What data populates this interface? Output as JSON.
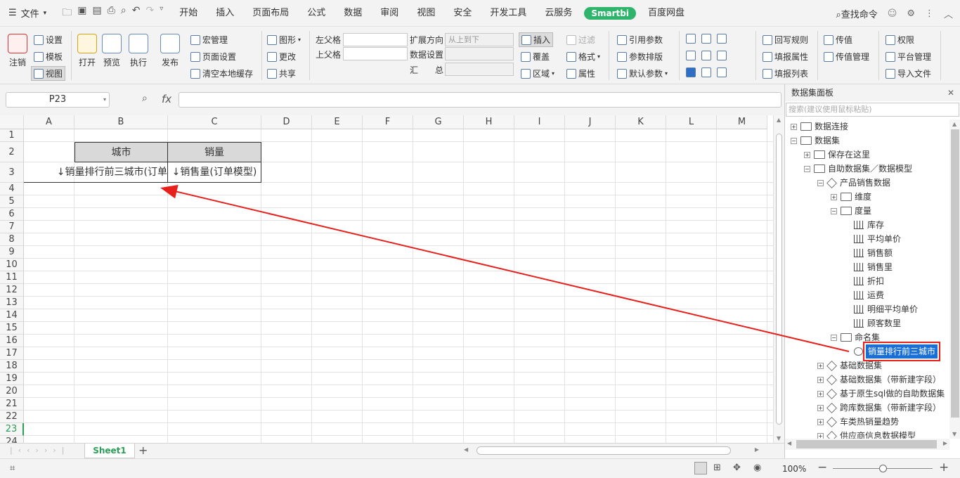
{
  "menu": {
    "file": "文件",
    "tabs": [
      "开始",
      "插入",
      "页面布局",
      "公式",
      "数据",
      "审阅",
      "视图",
      "安全",
      "开发工具",
      "云服务"
    ],
    "smartbi": "Smartbi",
    "extra_tab": "百度网盘",
    "search": "查找命令"
  },
  "ribbon": {
    "logout": "注销",
    "settings": "设置",
    "template": "模板",
    "view": "视图",
    "open": "打开",
    "preview": "预览",
    "execute": "执行",
    "publish": "发布",
    "macro": "宏管理",
    "page_setup": "页面设置",
    "clear_cache": "清空本地缓存",
    "graph": "图形",
    "change": "更改",
    "share": "共享",
    "left_parent": "左父格",
    "up_parent": "上父格",
    "expand_dir": "扩展方向",
    "expand_value": "从上到下",
    "data_setting": "数据设置",
    "summary": "汇　　总",
    "insert": "插入",
    "overwrite": "覆盖",
    "area": "区域",
    "filter": "过滤",
    "format": "格式",
    "property": "属性",
    "ref_param": "引用参数",
    "param_layout": "参数排版",
    "default_param": "默认参数",
    "writeback_rule": "回写规则",
    "fill_property": "填报属性",
    "fill_list": "填报列表",
    "pass_value": "传值",
    "pass_value_mgmt": "传值管理",
    "permission": "权限",
    "platform_mgmt": "平台管理",
    "import_file": "导入文件"
  },
  "formula_bar": {
    "cell_ref": "P23",
    "fx": "fx",
    "value": ""
  },
  "columns": [
    "A",
    "B",
    "C",
    "D",
    "E",
    "F",
    "G",
    "H",
    "I",
    "J",
    "K",
    "L",
    "M"
  ],
  "rows": [
    "1",
    "2",
    "3",
    "4",
    "5",
    "6",
    "7",
    "8",
    "9",
    "10",
    "11",
    "12",
    "13",
    "14",
    "15",
    "16",
    "17",
    "18",
    "19",
    "20",
    "21",
    "22",
    "23",
    "24"
  ],
  "cells": {
    "B2": "城市",
    "C2": "销量",
    "B3": "↓销量排行前三城市(订单",
    "C3": "↓销售量(订单模型)"
  },
  "sheet_tabs": [
    "Sheet1"
  ],
  "zoom": "100%",
  "panel": {
    "title": "数据集面板",
    "search_placeholder": "搜索(建议使用鼠标粘贴)",
    "tree": [
      {
        "label": "数据连接",
        "sign": "+"
      },
      {
        "label": "数据集",
        "sign": "−"
      },
      {
        "label": "保存在这里",
        "sign": "+"
      },
      {
        "label": "自助数据集／数据模型",
        "sign": "−"
      },
      {
        "label": "产品销售数据",
        "sign": "−"
      },
      {
        "label": "维度",
        "sign": "+"
      },
      {
        "label": "度量",
        "sign": "−"
      },
      {
        "label": "库存"
      },
      {
        "label": "平均单价"
      },
      {
        "label": "销售额"
      },
      {
        "label": "销售里"
      },
      {
        "label": "折扣"
      },
      {
        "label": "运费"
      },
      {
        "label": "明细平均单价"
      },
      {
        "label": "顾客数里"
      },
      {
        "label": "命名集",
        "sign": "−"
      },
      {
        "label": "销量排行前三城市"
      },
      {
        "label": "基础数据集",
        "sign": "+"
      },
      {
        "label": "基础数据集（带新建字段）",
        "sign": "+"
      },
      {
        "label": "基于原生sql做的自助数据集",
        "sign": "+"
      },
      {
        "label": "跨库数据集（带新建字段）",
        "sign": "+"
      },
      {
        "label": "车类热销量趋势",
        "sign": "+"
      },
      {
        "label": "供应商信息数据模型",
        "sign": "+"
      }
    ]
  },
  "colors": {
    "accent_green": "#2fb56b",
    "selection": "#1a6fd6",
    "annotation_red": "#e8201c"
  }
}
